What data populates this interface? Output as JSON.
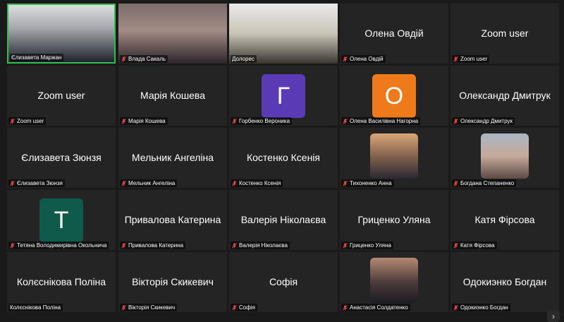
{
  "colors": {
    "active_border": "#2fbf4f",
    "muted_red": "#e5484d",
    "tile_bg": "#242424"
  },
  "tiles": [
    {
      "label": "Єлизавета Маржан",
      "center": "",
      "type": "video",
      "muted": false
    },
    {
      "label": "Влада Сакаль",
      "center": "",
      "type": "video",
      "muted": true
    },
    {
      "label": "Долорес",
      "center": "",
      "type": "video",
      "muted": false
    },
    {
      "label": "Олена Овдій",
      "center": "Олена Овдій",
      "type": "name",
      "muted": true
    },
    {
      "label": "Zoom user",
      "center": "Zoom user",
      "type": "name",
      "muted": true
    },
    {
      "label": "Zoom user",
      "center": "Zoom user",
      "type": "name",
      "muted": true
    },
    {
      "label": "Марія Кошева",
      "center": "Марія Кошева",
      "type": "name",
      "muted": true
    },
    {
      "label": "Горбенко Вероника",
      "center": "",
      "type": "avatar",
      "letter": "Г",
      "avatar_color": "#5a3bb5",
      "muted": true
    },
    {
      "label": "Олена Василівна Нагорна",
      "center": "",
      "type": "avatar",
      "letter": "О",
      "avatar_color": "#ef7a1a",
      "muted": true
    },
    {
      "label": "Олександр Дмитрук",
      "center": "Олександр Дмитрук",
      "type": "name",
      "muted": true
    },
    {
      "label": "Єлизавета Зюнзя",
      "center": "Єлизавета Зюнзя",
      "type": "name",
      "muted": true
    },
    {
      "label": "Мельник Ангеліна",
      "center": "Мельник Ангеліна",
      "type": "name",
      "muted": true
    },
    {
      "label": "Костенко Ксенія",
      "center": "Костенко Ксенія",
      "type": "name",
      "muted": true
    },
    {
      "label": "Тихоненко Анна",
      "center": "",
      "type": "photo",
      "muted": true
    },
    {
      "label": "Богдана Степаненко",
      "center": "",
      "type": "photo",
      "muted": true
    },
    {
      "label": "Тетяна Володимирівна Окольнича",
      "center": "",
      "type": "avatar",
      "letter": "T",
      "avatar_color": "#0f5a4a",
      "muted": true
    },
    {
      "label": "Привалова Катерина",
      "center": "Привалова Катерина",
      "type": "name",
      "muted": true
    },
    {
      "label": "Валерія Ніколаєва",
      "center": "Валерія Ніколаєва",
      "type": "name",
      "muted": true
    },
    {
      "label": "Гриценко Уляна",
      "center": "Гриценко Уляна",
      "type": "name",
      "muted": true
    },
    {
      "label": "Катя Фірсова",
      "center": "Катя Фірсова",
      "type": "name",
      "muted": true
    },
    {
      "label": "Колєснікова Поліна",
      "center": "Колєснікова Поліна",
      "type": "name",
      "muted": false
    },
    {
      "label": "Вікторія Скикевич",
      "center": "Вікторія Скикевич",
      "type": "name",
      "muted": true
    },
    {
      "label": "Софія",
      "center": "Софія",
      "type": "name",
      "muted": true
    },
    {
      "label": "Анастасія Солдатенко",
      "center": "",
      "type": "photo",
      "muted": true
    },
    {
      "label": "Одокиэнко Богдан",
      "center": "Одокиэнко Богдан",
      "type": "name",
      "muted": true
    }
  ],
  "next_page_icon": "chevron-right-icon",
  "next_page_glyph": "›"
}
